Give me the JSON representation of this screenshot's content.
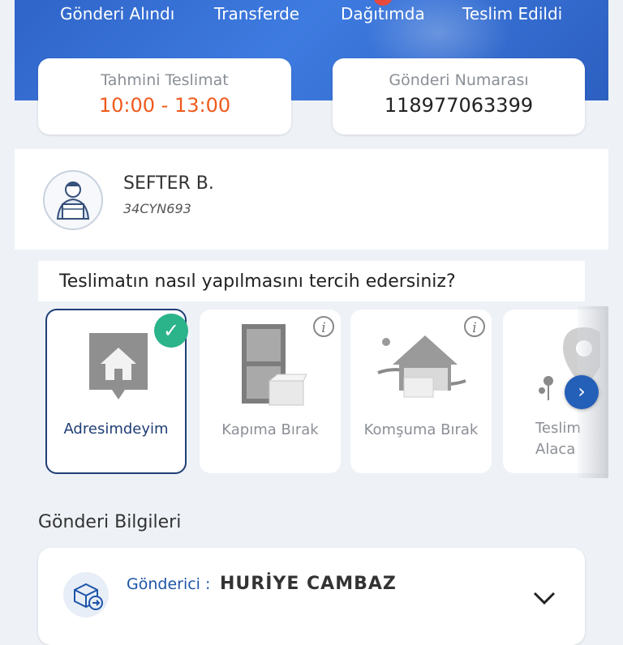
{
  "steps": [
    "Gönderi Alındı",
    "Transferde",
    "Dağıtımda",
    "Teslim Edildi"
  ],
  "eta": {
    "label": "Tahmini Teslimat",
    "value": "10:00 - 13:00"
  },
  "shipment": {
    "label": "Gönderi Numarası",
    "value": "118977063399"
  },
  "courier": {
    "name": "SEFTER B.",
    "plate": "34CYN693"
  },
  "question": "Teslimatın nasıl yapılmasını tercih edersiniz?",
  "options": [
    {
      "label": "Adresimdeyim",
      "selected": true,
      "icon": "home-icon"
    },
    {
      "label": "Kapıma Bırak",
      "icon": "door-icon"
    },
    {
      "label": "Komşuma Bırak",
      "icon": "neighbor-house-icon"
    },
    {
      "label_line1": "Teslim",
      "label_line2": "Alaca",
      "icon": "location-pin-icon"
    }
  ],
  "section_title": "Gönderi Bilgileri",
  "sender": {
    "label": "Gönderici :",
    "name": "HURİYE CAMBAZ"
  },
  "colors": {
    "brand_blue": "#2f64c8",
    "eta_orange": "#f05a1c",
    "check_green": "#2bb38a",
    "selected_border": "#1f3e75"
  }
}
